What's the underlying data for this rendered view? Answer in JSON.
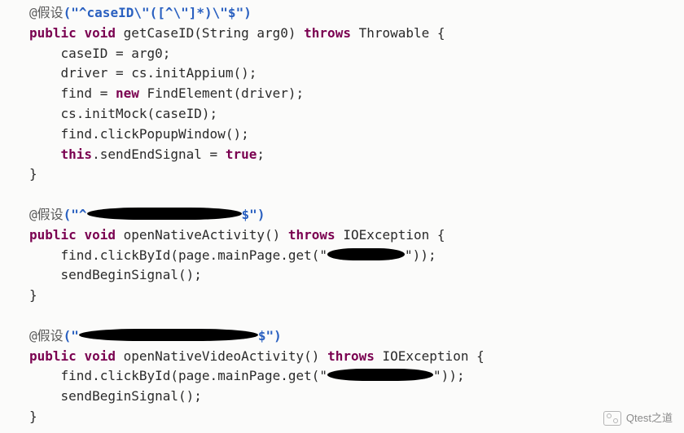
{
  "code": {
    "ann1_prefix": "@假设",
    "ann1_arg": "(\"^caseID\\\"([^\\\"]*)\\\"$\")",
    "sig1_a": "public",
    "sig1_b": "void",
    "sig1_name": " getCaseID(String arg0) ",
    "sig1_c": "throws",
    "sig1_rest": " Throwable {",
    "l1": "    caseID = arg0;",
    "l2": "    driver = cs.initAppium();",
    "l3a": "    find = ",
    "l3_new": "new",
    "l3b": " FindElement(driver);",
    "l4": "    cs.initMock(caseID);",
    "l5": "    find.clickPopupWindow();",
    "l6a": "    ",
    "l6_this": "this",
    "l6b": ".sendEndSignal = ",
    "l6_true": "true",
    "l6c": ";",
    "close": "}",
    "ann2_prefix": "@假设",
    "ann2_a": "(\"^",
    "ann2_b": "$\")",
    "sig2_a": "public",
    "sig2_b": "void",
    "sig2_name": " openNativeActivity() ",
    "sig2_c": "throws",
    "sig2_rest": " IOException {",
    "m1a": "    find.clickById(page.mainPage.get(\"",
    "m1b": "\"));",
    "m2": "    sendBeginSignal();",
    "ann3_prefix": "@假设",
    "ann3_a": "(\"",
    "ann3_b": "$\")",
    "sig3_a": "public",
    "sig3_b": "void",
    "sig3_name": " openNativeVideoActivity() ",
    "sig3_c": "throws",
    "sig3_rest": " IOException {",
    "n1a": "    find.clickById(page.mainPage.get(\"",
    "n1b": "\"));",
    "n2": "    sendBeginSignal();"
  },
  "watermark": "Qtest之道"
}
